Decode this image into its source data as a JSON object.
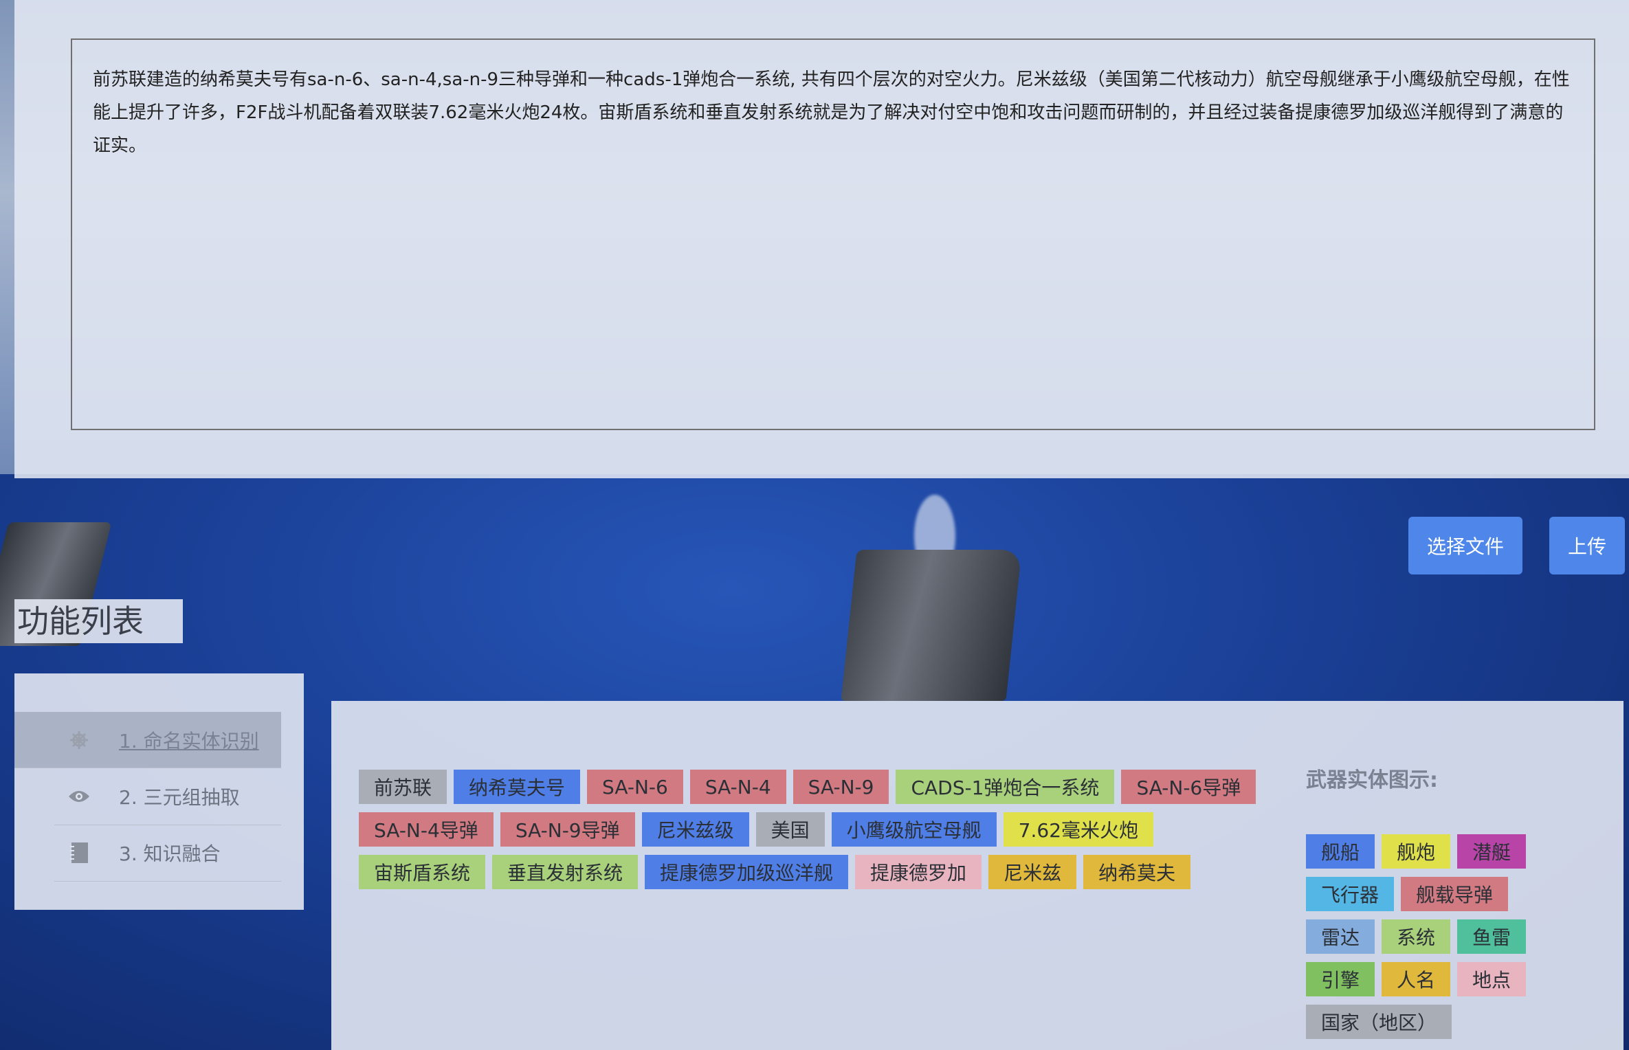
{
  "document": {
    "text": "前苏联建造的纳希莫夫号有sa-n-6、sa-n-4,sa-n-9三种导弹和一种cads-1弹炮合一系统, 共有四个层次的对空火力。尼米兹级（美国第二代核动力）航空母舰继承于小鹰级航空母舰，在性能上提升了许多，F2F战斗机配备着双联装7.62毫米火炮24枚。宙斯盾系统和垂直发射系统就是为了解决对付空中饱和攻击问题而研制的，并且经过装备提康德罗加级巡洋舰得到了满意的证实。"
  },
  "buttons": {
    "choose_file": "选择文件",
    "upload": "上传"
  },
  "function_list": {
    "title": "功能列表",
    "items": [
      {
        "label": "1. 命名实体识别",
        "icon": "ship-wheel-icon",
        "active": true
      },
      {
        "label": "2. 三元组抽取",
        "icon": "eye-icon",
        "active": false
      },
      {
        "label": "3. 知识融合",
        "icon": "book-icon",
        "active": false
      }
    ]
  },
  "entities": [
    {
      "text": "前苏联",
      "color": "#a9adb6"
    },
    {
      "text": "纳希莫夫号",
      "color": "#4e7ee6"
    },
    {
      "text": "SA-N-6",
      "color": "#d17a82"
    },
    {
      "text": "SA-N-4",
      "color": "#d17a82"
    },
    {
      "text": "SA-N-9",
      "color": "#d17a82"
    },
    {
      "text": "CADS-1弹炮合一系统",
      "color": "#a9d07a"
    },
    {
      "text": "SA-N-6导弹",
      "color": "#d17a82"
    },
    {
      "text": "SA-N-4导弹",
      "color": "#d17a82"
    },
    {
      "text": "SA-N-9导弹",
      "color": "#d17a82"
    },
    {
      "text": "尼米兹级",
      "color": "#4e7ee6"
    },
    {
      "text": "美国",
      "color": "#a9adb6"
    },
    {
      "text": "小鹰级航空母舰",
      "color": "#4e7ee6"
    },
    {
      "text": "7.62毫米火炮",
      "color": "#dfe04a"
    },
    {
      "text": "宙斯盾系统",
      "color": "#a9d07a"
    },
    {
      "text": "垂直发射系统",
      "color": "#a9d07a"
    },
    {
      "text": "提康德罗加级巡洋舰",
      "color": "#4e7ee6"
    },
    {
      "text": "提康德罗加",
      "color": "#e8b4bf"
    },
    {
      "text": "尼米兹",
      "color": "#e0b83b"
    },
    {
      "text": "纳希莫夫",
      "color": "#e0b83b"
    }
  ],
  "legend": {
    "title": "武器实体图示:",
    "items": [
      {
        "text": "舰船",
        "color": "#4e7ee6"
      },
      {
        "text": "舰炮",
        "color": "#dfe04a"
      },
      {
        "text": "潜艇",
        "color": "#b744a6"
      },
      {
        "text": "飞行器",
        "color": "#54b6e4"
      },
      {
        "text": "舰载导弹",
        "color": "#d17a82"
      },
      {
        "text": "雷达",
        "color": "#84acdc"
      },
      {
        "text": "系统",
        "color": "#a9d07a"
      },
      {
        "text": "鱼雷",
        "color": "#4fbf9c"
      },
      {
        "text": "引擎",
        "color": "#80c060"
      },
      {
        "text": "人名",
        "color": "#e0b83b"
      },
      {
        "text": "地点",
        "color": "#e8b4bf"
      },
      {
        "text": "国家（地区）",
        "color": "#a9adb6"
      }
    ]
  }
}
